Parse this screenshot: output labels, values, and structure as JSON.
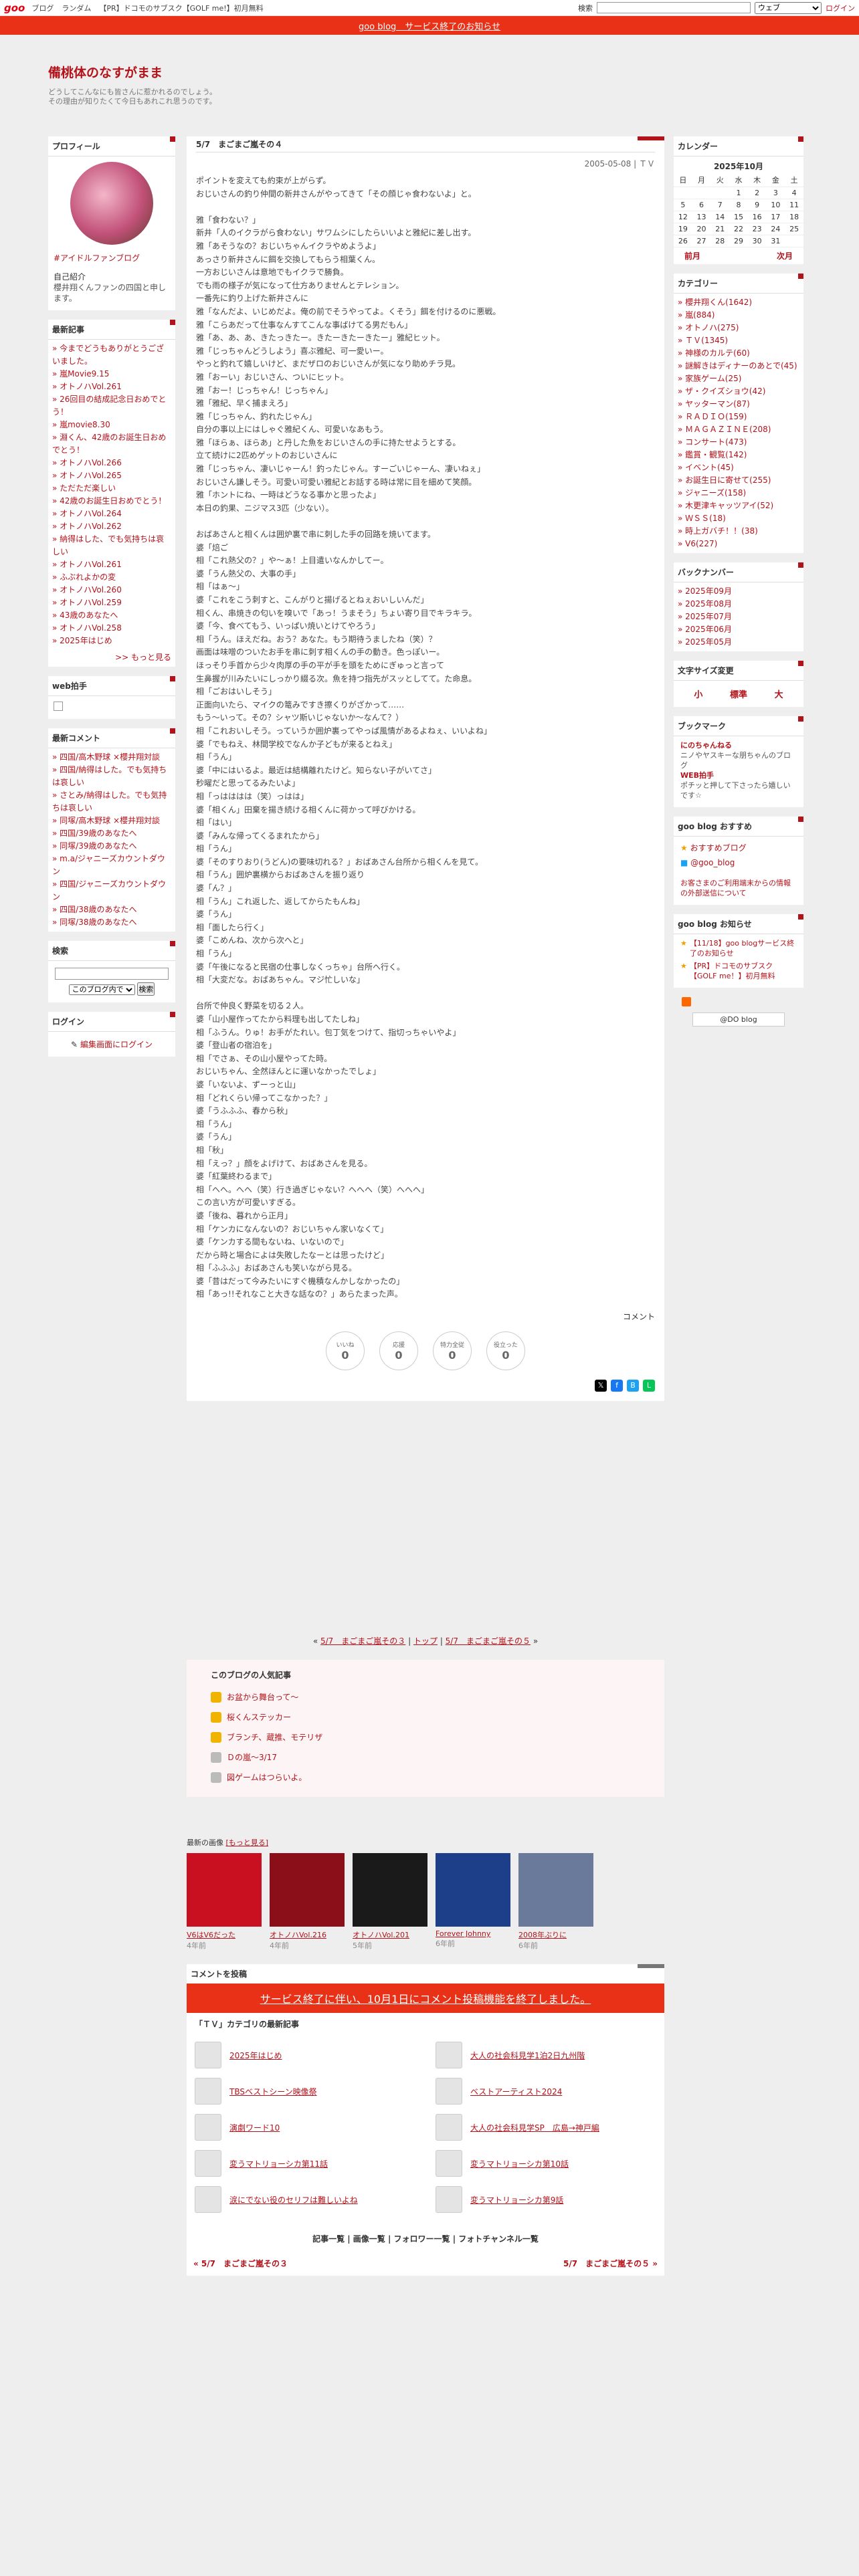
{
  "topbar": {
    "logo": "goo",
    "links": [
      "ブログ",
      "ランダム",
      "【PR】ドコモのサブスク【GOLF me!】初月無料"
    ],
    "search_placeholder": "",
    "search_label": "検索",
    "select_value": "ウェブ",
    "login": "ログイン"
  },
  "notice": "goo blog　サービス終了のお知らせ",
  "blog": {
    "title": "備桃体のなすがまま",
    "desc1": "どうしてこんなにも皆さんに惹かれるのでしょう。",
    "desc2": "その理由が知りたくて今日もあれこれ思うのです。"
  },
  "profile": {
    "heading": "プロフィール",
    "link": "#アイドルファンブログ",
    "intro_label": "自己紹介",
    "intro": "櫻井翔くんファンの四国と申します。"
  },
  "recent": {
    "heading": "最新記事",
    "items": [
      "今までどうもありがとうございました。",
      "嵐Movie9.15",
      "オトノハVol.261",
      "26回目の結成記念日おめでとう！",
      "嵐movie8.30",
      "淵くん、42歳のお誕生日おめでとう！",
      "オトノハVol.266",
      "オトノハVol.265",
      "ただただ楽しい",
      "42歳のお誕生日おめでとう！",
      "オトノハVol.264",
      "オトノハVol.262",
      "納得はした、でも気持ちは哀しい",
      "オトノハVol.261",
      "ふぶれよかの変",
      "オトノハVol.260",
      "オトノハVol.259",
      "43歳のあなたへ",
      "オトノハVol.258",
      "2025年はじめ"
    ],
    "more": ">> もっと見る"
  },
  "webclap": {
    "heading": "web拍手"
  },
  "comments": {
    "heading": "最新コメント",
    "items": [
      "四国/高木野球 ×櫻井翔対談",
      "四国/納得はした。でも気持ちは哀しい",
      "さとみ/納得はした。でも気持ちは哀しい",
      "同塚/高木野球 ×櫻井翔対談",
      "四国/39歳のあなたへ",
      "同塚/39歳のあなたへ",
      "m.a/ジャニーズカウントダウン",
      "四国/ジャニーズカウントダウン",
      "四国/38歳のあなたへ",
      "同塚/38歳のあなたへ"
    ]
  },
  "search": {
    "heading": "検索",
    "select": "このブログ内で",
    "button": "検索"
  },
  "login": {
    "heading": "ログイン",
    "link": "編集画面にログイン"
  },
  "article": {
    "title": "5/7　まごまご嵐その４",
    "date": "2005-05-08 | ＴＶ",
    "body": "ポイントを変えても約束が上がらず。\nおじいさんの釣り仲間の新井さんがやってきて「その顔じゃ食わないよ」と。\n\n雅「食わない？」\n新井「人のイクラがら食わない」サワムシにしたらいいよと雅紀に差し出す。\n雅「あそうなの？おじいちゃんイクラやめようよ」\nあっさり新井さんに餌を交換してもらう相葉くん。\n一方おじいさんは意地でもイクラで勝負。\nでも雨の様子が気になって仕方ありませんとテレション。\n一番先に釣り上げた新井さんに\n雅「なんだよ、いじめだよ。俺の前でそうやってよ。くそう」餌を付けるのに悪戦。\n雅「こらあだって仕事なんすてこんな事ばけてる男だもん」\n雅「あ、あ、あ、きたっきたー。きたーきたーきたー」雅紀ヒット。\n雅「じっちゃんどうしよう」喜ぶ雅紀、可一愛いー。\nやっと釣れて嬉しいけど、まだザロのおじいさんが気になり助めチラ見。\n雅「おーい」おじいさん、ついにヒット。\n雅「おー！じっちゃん！じっちゃん」\n雅「雅紀、早く捕まえろ」\n雅「じっちゃん、釣れたじゃん」\n自分の事以上にはしゃぐ雅紀くん、可愛いなあもう。\n雅「ほらぁ、ほらあ」と丹した魚をおじいさんの手に持たせようとする。\n立て続けに2匹めゲットのおじいさんに\n雅「じっちゃん、凄いじゃーん！釣ったじゃん。すーごいじゃーん、凄いねぇ」\nおじいさん謙しそう。可愛い可愛い雅紀とお話する時は常に目を細めて笑顔。\n雅「ホントにね、一時はどうなる事かと思ったよ」\n本日の釣果、ニジマス3匹（少ない）。\n\nおばあさんと相くんは囲炉裏で串に刺した手の回路を焼いてます。\n婆「焙ご\n相「これ熱父の？」や～ぁ！上目遣いなんかしてー。\n婆「うん熱父の、大事の手」\n相「はぁ～」\n婆「これをこう刺すと、こんがりと揚げるとねぇおいしいんだ」\n相くん、串焼きの匂いを嗅いで「あっ！うまそう」ちょい寄り目でキラキラ。\n婆「今、食べてもう、いっぱい焼いとけてやろう」\n相「うん。ほえだね。おう？あなた。もう期待うましたね（笑）？\n画面は味噌のついたお手を串に刺す相くんの手の動き。色っぽいー。\nほっそり手首から少々肉厚の手の平が手を頭をためにぎゅっと言って\n生鼻握が川みたいにしっかり綴る次。魚を持つ指先がスッとしてて。た命息。\n相「ごおはいしそう」\n正面向いたら、マイクの篭みですき擦くりがざかって……\nもう～いって。その？シャツ斯いじゃないか～なんて？）\n相「これおいしそう。っていうか囲炉裏ってやっぱ風情があるよねぇ、いいよね」\n婆「でもねえ、林間学校でなんか子どもが来るとねえ」\n相「うん」\n婆「中にはいるよ。最近は結構離れたけど。知らない子がいてさ」\n秒曜だと思ってるみたいよ」\n相「っはははは（笑）っはは」\n婆「相くん」田棄を揚き続ける相くんに荷かって呼びかける。\n相「はい」\n婆「みんな帰ってくるまれたから」\n相「うん」\n婆「そのすりおり(うどん)の要味切れる？」おばあさん台所から相くんを見て。\n相「うん」囲炉裏横からおばあさんを振り返り\n婆「ん？」\n相「うん」これ返した、返してからたもんね」\n婆「うん」\n相「面したら行く」\n婆「こめんね、次から次へと」\n相「うん」\n婆「午後になると民宿の仕事しなくっちゃ」台所へ行く。\n相「大変だな。おばあちゃん。マジ忙しいな」\n\n台所で仲良く野菜を切る２人。\n婆「山小屋作ってたから料理も出してたしね」\n相「ふうん。りゅ！お手がたれい。包丁気をつけて、指切っちゃいやよ」\n婆「登山者の宿泊を」\n相「でさぁ、その山小屋やってた時。\nおじいちゃん、全然ほんとに運いなかったでしょ」\n婆「いないよ、ずーっと山」\n相「どれくらい帰ってこなかった？」\n婆「うふふふ、春から秋」\n相「うん」\n婆「うん」\n相「秋」\n相「えっ？」顔をよげけて、おばあさんを見る。\n婆「紅葉終わるまで」\n相「へへ。へへ（笑）行き過ぎじゃない？へへへ（笑）へへへ」\nこの言い方が可愛いすぎる。\n婆「後ね、暮れから正月」\n相「ケンカになんないの？おじいちゃん家いなくて」\n婆「ケンカする間もないね、いないので」\nだから時と場合によは失敗したなーとは思ったけど」\n相「ふふふ」おばあさんも笑いながら見る。\n婆「昔はだって今みたいにすぐ機積なんかしなかったの」\n相「あっ!!それなこと大きな話なの？」あらたまった声。",
    "comment_label": "コメント"
  },
  "reactions": [
    {
      "label": "いいね",
      "count": "0"
    },
    {
      "label": "応援",
      "count": "0"
    },
    {
      "label": "特力全従",
      "count": "0"
    },
    {
      "label": "役立った",
      "count": "0"
    }
  ],
  "pager": {
    "prev": "5/7　まごまご嵐その３",
    "top": "トップ",
    "next": "5/7　まごまご嵐その５"
  },
  "popular": {
    "heading": "このブログの人気記事",
    "items": [
      "お盆から舞台って～",
      "桜くんステッカー",
      "ブランチ、蔵推、モテリザ",
      "Ｄの嵐～3/17",
      "図ゲームはつらいよ。"
    ]
  },
  "images": {
    "heading": "最新の画像",
    "more": "[もっと見る]",
    "items": [
      {
        "title": "V6はV6だった",
        "ago": "4年前"
      },
      {
        "title": "オトノハVol.216",
        "ago": "4年前"
      },
      {
        "title": "オトノハVol.201",
        "ago": "5年前"
      },
      {
        "title": "Forever Johnny",
        "ago": "6年前"
      },
      {
        "title": "2008年ぶりに",
        "ago": "6年前"
      }
    ]
  },
  "comment_form": {
    "heading": "コメントを投稿",
    "banner": "サービス終了に伴い、10月1日にコメント投稿機能を終了しました。"
  },
  "category_latest": {
    "heading": "「ＴＶ」カテゴリの最新記事",
    "items": [
      "2025年はじめ",
      "大人の社会科見学1泊2日九州階",
      "TBSベストシーン映像祭",
      "ベストアーティスト2024",
      "演劇ワード10",
      "大人の社会科見学SP　広島→神戸編",
      "変うマトリョーシカ第11話",
      "変うマトリョーシカ第10話",
      "涙にでない役のセリフは難しいよね",
      "変うマトリョーシカ第9話"
    ]
  },
  "bottom_links": "記事一覧 | 画像一覧 | フォロワー一覧 | フォトチャンネル一覧",
  "prevnext": {
    "prev": "« 5/7　まごまご嵐その３",
    "next": "5/7　まごまご嵐その５ »"
  },
  "calendar": {
    "heading": "カレンダー",
    "title": "2025年10月",
    "days": [
      "日",
      "月",
      "火",
      "水",
      "木",
      "金",
      "土"
    ],
    "rows": [
      [
        "",
        "",
        "",
        "1",
        "2",
        "3",
        "4"
      ],
      [
        "5",
        "6",
        "7",
        "8",
        "9",
        "10",
        "11"
      ],
      [
        "12",
        "13",
        "14",
        "15",
        "16",
        "17",
        "18"
      ],
      [
        "19",
        "20",
        "21",
        "22",
        "23",
        "24",
        "25"
      ],
      [
        "26",
        "27",
        "28",
        "29",
        "30",
        "31",
        ""
      ]
    ],
    "prev": "前月",
    "next": "次月"
  },
  "categories": {
    "heading": "カテゴリー",
    "items": [
      "櫻井翔くん(1642)",
      "嵐(884)",
      "オトノハ(275)",
      "ＴＶ(1345)",
      "神様のカルテ(60)",
      "謎解きはディナーのあとで(45)",
      "家族ゲーム(25)",
      "ザ・クイズショウ(42)",
      "ヤッターマン(87)",
      "ＲＡＤＩＯ(159)",
      "ＭＡＧＡＺＩＮＥ(208)",
      "コンサート(473)",
      "鑑賞・観覧(142)",
      "イベント(45)",
      "お誕生日に寄せて(255)",
      "ジャニーズ(158)",
      "木更津キャッツアイ(52)",
      "ＷＳＳ(18)",
      "時上ガバチ！！(38)",
      "V6(227)"
    ]
  },
  "backnumber": {
    "heading": "バックナンバー",
    "items": [
      "2025年09月",
      "2025年08月",
      "2025年07月",
      "2025年06月",
      "2025年05月"
    ]
  },
  "fontsize": {
    "heading": "文字サイズ変更",
    "small": "小",
    "normal": "標準",
    "large": "大"
  },
  "bookmarks": {
    "heading": "ブックマーク",
    "items": [
      {
        "name": "にのちゃんねる",
        "desc": "ニノやヤスキーな朋ちゃんのブログ"
      },
      {
        "name": "WEB拍手",
        "desc": "ポチッと押して下さったら嬉しいです☆"
      }
    ]
  },
  "goo_recommend": {
    "heading": "goo blog おすすめ",
    "items": [
      "おすすめブログ",
      "@goo_blog"
    ],
    "note": "お客さまのご利用端末からの情報の外部送信について"
  },
  "goo_notice": {
    "heading": "goo blog お知らせ",
    "items": [
      "【11/18】goo blogサービス終了のお知らせ",
      "【PR】ドコモのサブスク【GOLF me！】初月無料"
    ],
    "badge": "@DO blog"
  }
}
